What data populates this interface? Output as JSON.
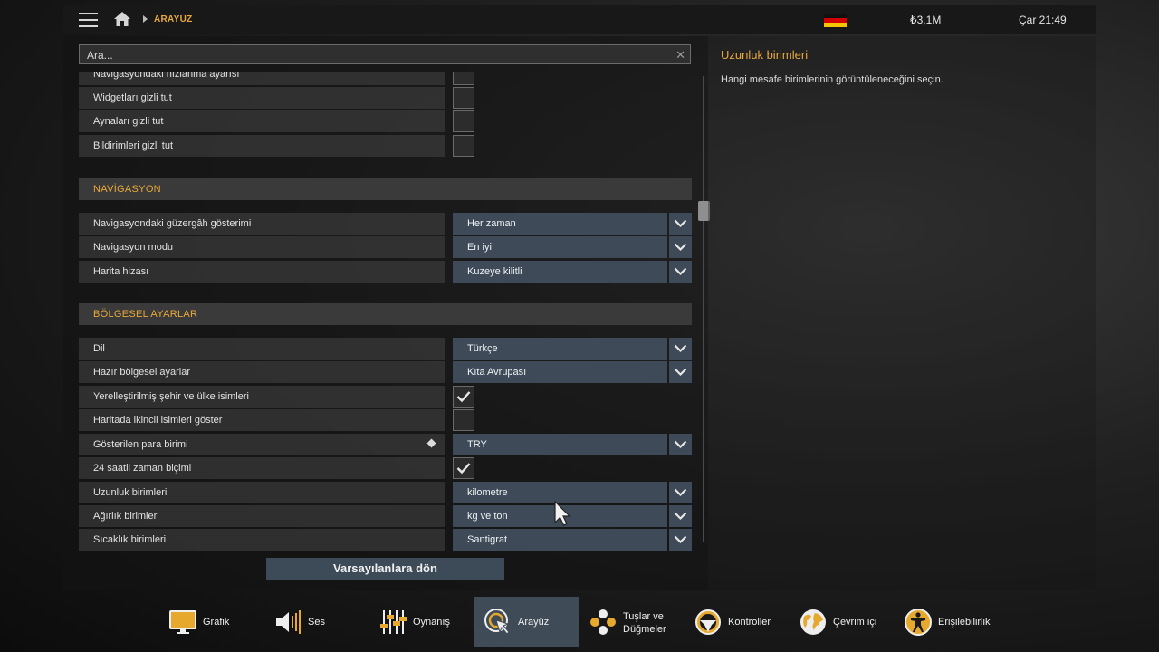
{
  "topbar": {
    "breadcrumb": "ARAYÜZ",
    "money": "₺3,1M",
    "clock": "Çar 21:49"
  },
  "search": {
    "placeholder": "Ara..."
  },
  "settings": {
    "partial_top_label": "Navigasyondaki hızlanma ayarısı",
    "rows_top": [
      {
        "label": "Widgetları gizli tut",
        "checked": false
      },
      {
        "label": "Aynaları gizli tut",
        "checked": false
      },
      {
        "label": "Bildirimleri gizli tut",
        "checked": false
      }
    ],
    "section_nav": "NAVİGASYON",
    "rows_nav": [
      {
        "label": "Navigasyondaki güzergâh gösterimi",
        "value": "Her zaman"
      },
      {
        "label": "Navigasyon modu",
        "value": "En iyi"
      },
      {
        "label": "Harita hizası",
        "value": "Kuzeye kilitli"
      }
    ],
    "section_regional": "BÖLGESEL AYARLAR",
    "rows_regional": [
      {
        "label": "Dil",
        "value": "Türkçe"
      },
      {
        "label": "Hazır bölgesel ayarlar",
        "value": "Kıta Avrupası"
      },
      {
        "label": "Yerelleştirilmiş şehir ve ülke isimleri",
        "checked": true
      },
      {
        "label": "Haritada ikincil isimleri göster",
        "checked": false
      },
      {
        "label": "Gösterilen para birimi",
        "value": "TRY"
      },
      {
        "label": "24 saatli zaman biçimi",
        "checked": true
      },
      {
        "label": "Uzunluk birimleri",
        "value": "kilometre"
      },
      {
        "label": "Ağırlık birimleri",
        "value": "kg ve ton"
      },
      {
        "label": "Sıcaklık birimleri",
        "value": "Santigrat"
      }
    ]
  },
  "defaults_button": "Varsayılanlara dön",
  "description": {
    "title": "Uzunluk birimleri",
    "text": "Hangi mesafe birimlerinin görüntüleneceğini seçin."
  },
  "nav": [
    {
      "label": "Grafik",
      "icon": "monitor-icon"
    },
    {
      "label": "Ses",
      "icon": "speaker-icon"
    },
    {
      "label": "Oynanış",
      "icon": "sliders-icon"
    },
    {
      "label": "Arayüz",
      "icon": "cursor-target-icon",
      "active": true
    },
    {
      "label": "Tuşlar ve",
      "label2": "Düğmeler",
      "icon": "keys-icon"
    },
    {
      "label": "Kontroller",
      "icon": "steering-wheel-icon"
    },
    {
      "label": "Çevrim içi",
      "icon": "globe-icon"
    },
    {
      "label": "Erişilebilirlik",
      "icon": "accessibility-icon"
    }
  ],
  "colors": {
    "accent": "#e9a83a",
    "dropdown_bg": "#3e4a57",
    "active_tab": "#3f4b57"
  }
}
